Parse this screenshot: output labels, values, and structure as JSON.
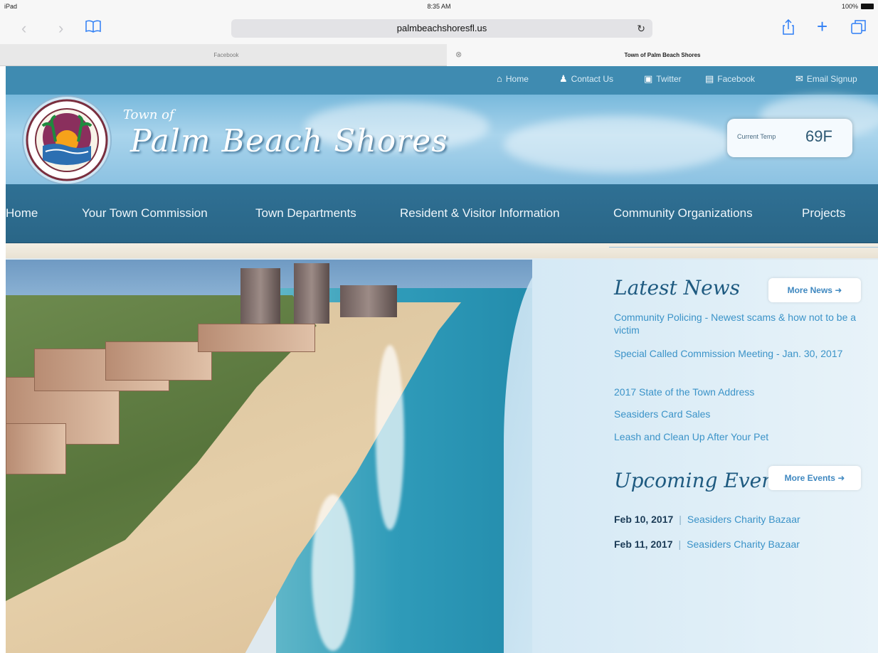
{
  "status_bar": {
    "device": "iPad",
    "time": "8:35 AM",
    "battery": "100%"
  },
  "browser": {
    "url": "palmbeachshoresfl.us",
    "tabs": [
      {
        "label": "Facebook",
        "active": false
      },
      {
        "label": "Town of Palm Beach Shores",
        "active": true
      }
    ]
  },
  "top_links": [
    {
      "label": "Home",
      "icon": "home-icon"
    },
    {
      "label": "Contact Us",
      "icon": "person-icon"
    },
    {
      "label": "Twitter",
      "icon": "twitter-icon"
    },
    {
      "label": "Facebook",
      "icon": "facebook-icon"
    },
    {
      "label": "Email Signup",
      "icon": "email-icon"
    }
  ],
  "header": {
    "town_of": "Town of",
    "town_name": "Palm Beach Shores",
    "temp_label": "Current Temp",
    "temp_value": "69F"
  },
  "nav": [
    "Home",
    "Your Town Commission",
    "Town Departments",
    "Resident & Visitor Information",
    "Community Organizations",
    "Projects"
  ],
  "latest_news": {
    "heading": "Latest News",
    "more_label": "More News",
    "items": [
      "Community Policing - Newest scams & how not to be a victim",
      "Special Called Commission Meeting - Jan. 30, 2017",
      "2017 State of the Town Address",
      "Seasiders Card Sales",
      "Leash and Clean Up After Your Pet"
    ]
  },
  "upcoming_events": {
    "heading": "Upcoming Events",
    "more_label": "More Events",
    "items": [
      {
        "date": "Feb 10, 2017",
        "title": "Seasiders Charity Bazaar"
      },
      {
        "date": "Feb 11, 2017",
        "title": "Seasiders Charity Bazaar"
      }
    ]
  },
  "colors": {
    "accent": "#3f8bb1",
    "nav": "#2f7094",
    "link": "#3b93c8"
  }
}
